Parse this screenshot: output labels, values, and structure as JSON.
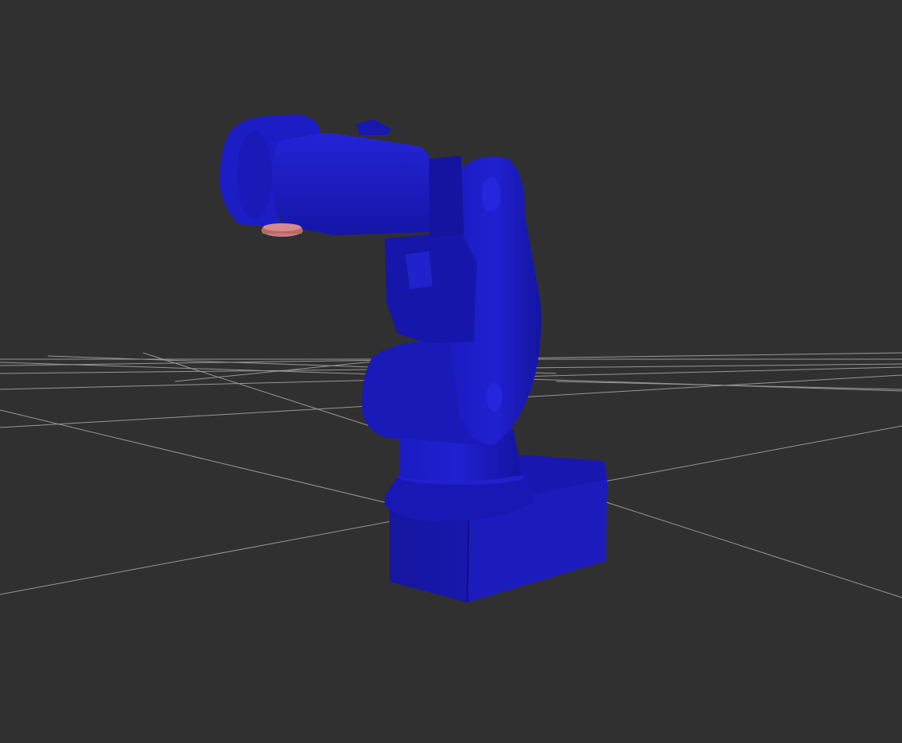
{
  "scene": {
    "background_color": "#303030",
    "grid_color": "#a0a0a4",
    "robot_color": "#1a1ab4",
    "robot_shadow_color": "#10107a",
    "robot_highlight_color": "#2a2ae0",
    "flange_color": "#c87a7a",
    "objects": [
      "ground-grid",
      "robot-arm",
      "tool-flange"
    ]
  }
}
